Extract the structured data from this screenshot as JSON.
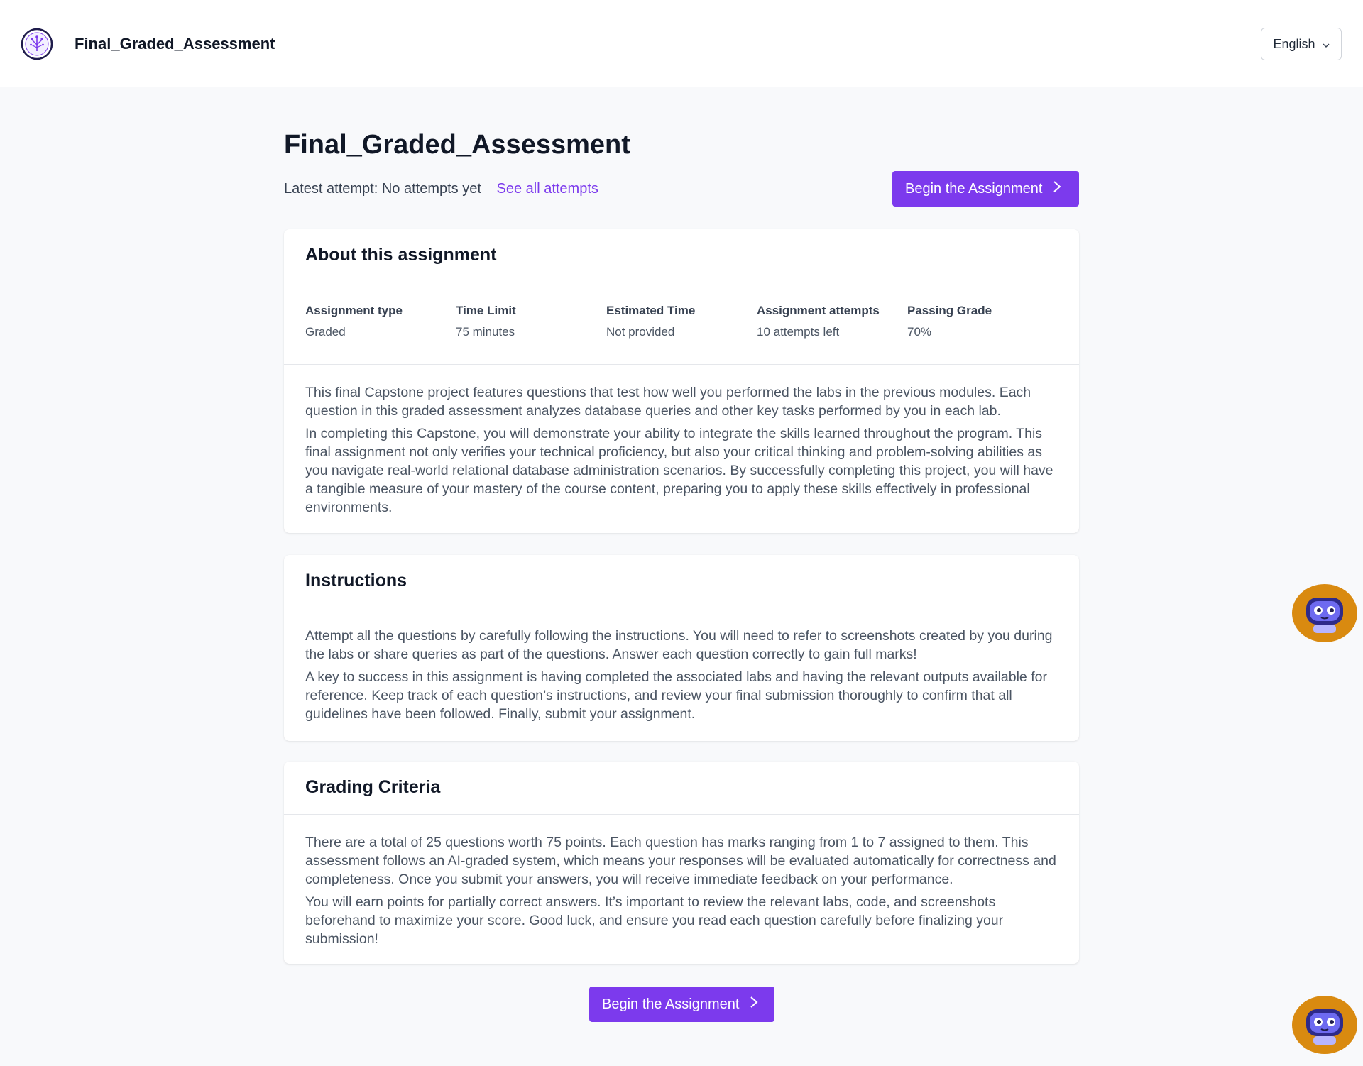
{
  "header": {
    "app_title": "Final_Graded_Assessment",
    "language": "English",
    "logo_icon": "tree-logo-icon"
  },
  "page": {
    "title": "Final_Graded_Assessment",
    "latest_attempt": "Latest attempt: No attempts yet",
    "see_all_attempts": "See all attempts",
    "begin_button": "Begin the Assignment"
  },
  "about": {
    "heading": "About this assignment",
    "meta": [
      {
        "label": "Assignment type",
        "value": "Graded"
      },
      {
        "label": "Time Limit",
        "value": "75 minutes"
      },
      {
        "label": "Estimated Time",
        "value": "Not provided"
      },
      {
        "label": "Assignment attempts",
        "value": "10 attempts left"
      },
      {
        "label": "Passing Grade",
        "value": "70%"
      }
    ],
    "paragraphs": [
      "This final Capstone project features questions that test how well you performed the labs in the previous modules. Each question in this graded assessment analyzes database queries and other key tasks performed by you in each lab.",
      "In completing this Capstone, you will demonstrate your ability to integrate the skills learned throughout the program. This final assignment not only verifies your technical proficiency, but also your critical thinking and problem-solving abilities as you navigate real-world relational database administration scenarios. By successfully completing this project, you will have a tangible measure of your mastery of the course content, preparing you to apply these skills effectively in professional environments."
    ]
  },
  "instructions": {
    "heading": "Instructions",
    "paragraphs": [
      "Attempt all the questions by carefully following the instructions. You will need to refer to screenshots created by you during the labs or share queries as part of the questions. Answer each question correctly to gain full marks!",
      "A key to success in this assignment is having completed the associated labs and having the relevant outputs available for reference. Keep track of each question’s instructions, and review your final submission thoroughly to confirm that all guidelines have been followed. Finally, submit your assignment."
    ]
  },
  "grading": {
    "heading": "Grading Criteria",
    "paragraphs": [
      "There are a total of 25 questions worth 75 points. Each question has marks ranging from 1 to 7 assigned to them. This assessment follows an AI-graded system, which means your responses will be evaluated automatically for correctness and completeness. Once you submit your answers, you will receive immediate feedback on your performance.",
      "You will earn points for partially correct answers. It’s important to review the relevant labs, code, and screenshots beforehand to maximize your score. Good luck, and ensure you read each question carefully before finalizing your submission!"
    ]
  },
  "colors": {
    "accent": "#7c3aed",
    "bot_orange": "#d98a10",
    "bot_blue": "#4f46e5"
  },
  "icons": {
    "chevron_right": "chevron-right-icon",
    "chevron_down": "chevron-down-icon",
    "assistant": "chatbot-icon"
  }
}
